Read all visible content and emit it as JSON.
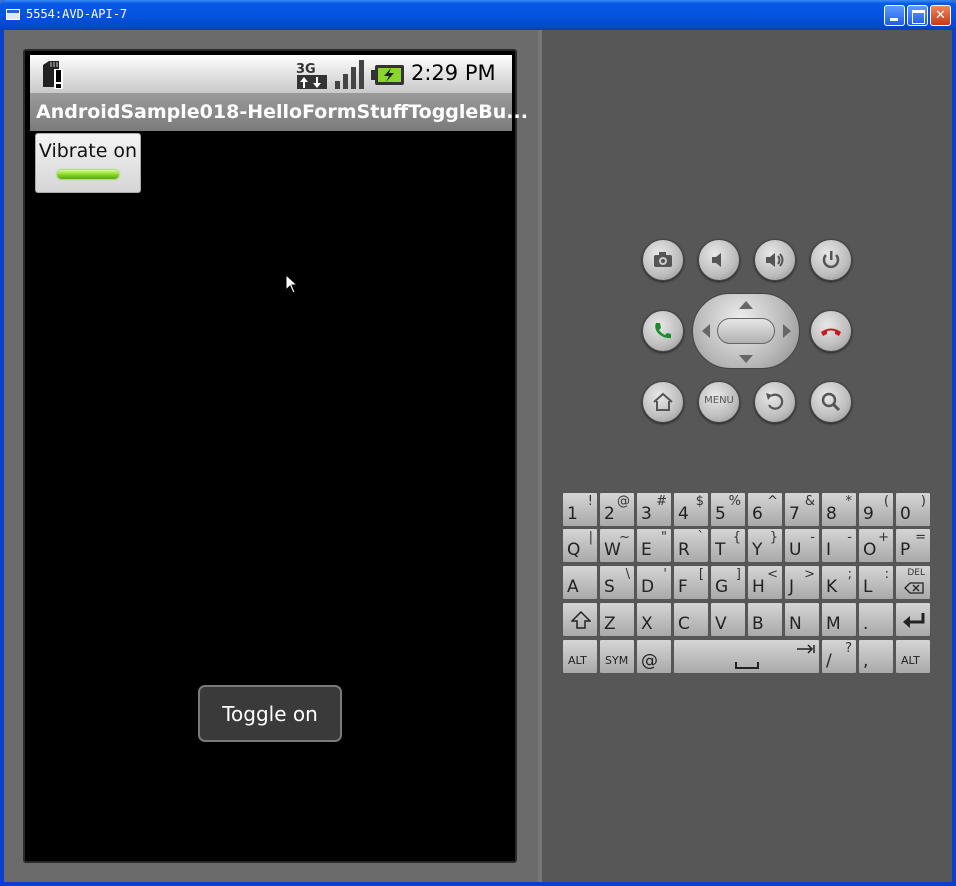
{
  "window": {
    "title": "5554:AVD-API-7"
  },
  "status_bar": {
    "time": "2:29 PM",
    "network": "3G"
  },
  "app": {
    "title": "AndroidSample018-HelloFormStuffToggleBu..."
  },
  "toggle_button": {
    "label": "Vibrate on",
    "state": "on"
  },
  "toast": {
    "text": "Toggle on"
  },
  "hardware_buttons": [
    "camera",
    "volume-down",
    "volume-up",
    "power",
    "call",
    "dpad",
    "end-call",
    "home",
    "menu",
    "back",
    "search"
  ],
  "menu_button_label": "MENU",
  "keyboard": {
    "row1": [
      [
        "1",
        "!"
      ],
      [
        "2",
        "@"
      ],
      [
        "3",
        "#"
      ],
      [
        "4",
        "$"
      ],
      [
        "5",
        "%"
      ],
      [
        "6",
        "^"
      ],
      [
        "7",
        "&"
      ],
      [
        "8",
        "*"
      ],
      [
        "9",
        "("
      ],
      [
        "0",
        ")"
      ]
    ],
    "row2": [
      [
        "Q",
        "|"
      ],
      [
        "W",
        "~"
      ],
      [
        "E",
        "\""
      ],
      [
        "R",
        "`"
      ],
      [
        "T",
        "{"
      ],
      [
        "Y",
        "}"
      ],
      [
        "U",
        "-"
      ],
      [
        "I",
        "-"
      ],
      [
        "O",
        "+"
      ],
      [
        "P",
        "="
      ]
    ],
    "row3": [
      [
        "A",
        ""
      ],
      [
        "S",
        "\\"
      ],
      [
        "D",
        "'"
      ],
      [
        "F",
        "["
      ],
      [
        "G",
        "]"
      ],
      [
        "H",
        "<"
      ],
      [
        "J",
        ">"
      ],
      [
        "K",
        ";"
      ],
      [
        "L",
        ":"
      ],
      [
        "DEL",
        ""
      ]
    ],
    "row4": [
      [
        "Z",
        ""
      ],
      [
        "X",
        ""
      ],
      [
        "C",
        ""
      ],
      [
        "V",
        ""
      ],
      [
        "B",
        ""
      ],
      [
        "N",
        ""
      ],
      [
        "M",
        ""
      ],
      [
        ".",
        ""
      ]
    ],
    "row5": {
      "alt_left": "ALT",
      "sym": "SYM",
      "at": "@",
      "slash": "/",
      "slash_alt": "?",
      "comma": ",",
      "alt_right": "ALT"
    }
  },
  "colors": {
    "led_on": "#7cd01a",
    "titlebar": "#0553e0"
  }
}
